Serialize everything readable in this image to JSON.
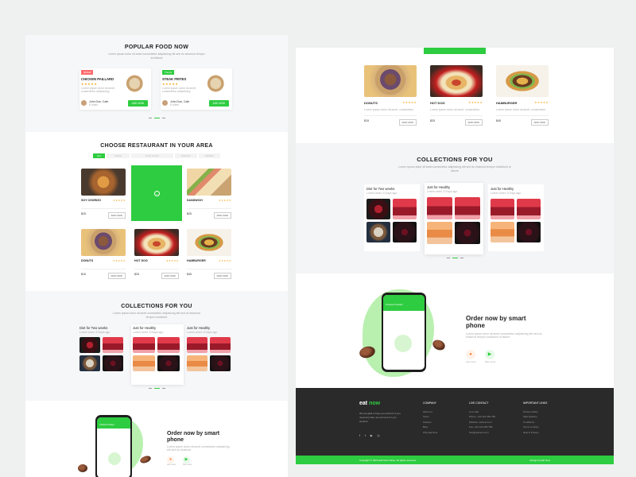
{
  "left": {
    "popular": {
      "title": "POPULAR FOOD NOW",
      "subtitle": "Lorem ipsum dolor sit amet consectetur adipisicing elit sed do eiusmod tempor incididunt",
      "cards": [
        {
          "badge": "30%off",
          "name": "CHICKEN PAILLARD",
          "stars": "★★★★★",
          "desc": "Lorem ipsum dolor sit amet consectetur adipisicing",
          "author": "John Doe, Cafe",
          "meta": "8 miles",
          "button": "ADD NOW"
        },
        {
          "badge": "Trendy",
          "name": "STEAK FRITES",
          "stars": "★★★★★",
          "desc": "Lorem ipsum dolor sit amet consectetur adipisicing",
          "author": "John Doe, Cafe",
          "meta": "8 miles",
          "button": "ADD NOW"
        }
      ]
    },
    "restaurant": {
      "title": "CHOOSE RESTAURANT IN YOUR AREA",
      "tabs": [
        "ALL",
        "PIZZA",
        "FAST FOOD",
        "STEAKS",
        "DRINKS"
      ],
      "items": [
        {
          "name": "SOY CHORIZO",
          "stars": "★★★★★",
          "price": "$25",
          "button": "ADD NOW",
          "img": "food-pizza"
        },
        {
          "name": "SANDWICH",
          "stars": "★★★★★",
          "price": "$25",
          "button": "ADD NOW",
          "img": "food-sandwich"
        },
        {
          "name": "DONUTS",
          "stars": "★★★★★",
          "price": "$15",
          "button": "ADD NOW",
          "img": "food-donut"
        },
        {
          "name": "HOT DOG",
          "stars": "★★★★★",
          "price": "$25",
          "button": "ADD NOW",
          "img": "food-hotdog"
        },
        {
          "name": "HAMBURGER",
          "stars": "★★★★★",
          "price": "$45",
          "button": "ADD NOW",
          "img": "food-burger"
        }
      ]
    },
    "collections": {
      "title": "COLLECTIONS FOR YOU",
      "subtitle": "Lorem ipsum dolor sit amet consectetur adipisicing elit sed do eiusmod tempor incididunt",
      "cards": [
        {
          "title": "Diet for Two weeks",
          "meta": "Lorem amet, 5 Days ago"
        },
        {
          "title": "Just for Healthy",
          "meta": "Lorem amet, 5 Days ago"
        },
        {
          "title": "Just for Healthy",
          "meta": "Lorem amet, 5 Days ago"
        }
      ]
    },
    "order": {
      "title": "Order now by smart phone",
      "desc": "Lorem ipsum dolor sit amet consectetur adipisicing elit sed do eiusmod",
      "app_store": "App store",
      "play_store": "Play store",
      "screen_header": "Choose Position"
    }
  },
  "right": {
    "foods": [
      {
        "name": "DONUTS",
        "stars": "★★★★★",
        "desc": "Lorem ipsum dolor sit amet, consectetur",
        "price": "$15",
        "button": "ADD NOW",
        "img": "food-donut"
      },
      {
        "name": "HOT DOG",
        "stars": "★★★★★",
        "desc": "Lorem ipsum dolor sit amet, consectetur",
        "price": "$25",
        "button": "ADD NOW",
        "img": "food-hotdog"
      },
      {
        "name": "HAMBURGER",
        "stars": "★★★★★",
        "desc": "Lorem ipsum dolor sit amet, consectetur",
        "price": "$45",
        "button": "ADD NOW",
        "img": "food-burger"
      }
    ],
    "collections": {
      "title": "COLLECTIONS FOR YOU",
      "subtitle": "Lorem ipsum dolor sit amet consectetur adipisicing elit sed do eiusmod tempor incididunt ut labore",
      "cards": [
        {
          "title": "Diet for Two weeks",
          "meta": "Lorem amet, 5 Days ago"
        },
        {
          "title": "Just for Healthy",
          "meta": "Lorem amet, 5 Days ago"
        },
        {
          "title": "Just for Healthy",
          "meta": "Lorem amet, 5 Days ago"
        }
      ]
    },
    "order": {
      "title": "Order now by smart phone",
      "desc": "Lorem ipsum dolor sit amet consectetur adipisicing elit sed do eiusmod tempor incididunt ut labore",
      "app_store": "App store",
      "play_store": "Play store",
      "screen_header": "Choose Position"
    },
    "footer": {
      "brand_a": "eat",
      "brand_b": "now",
      "about": "We are glad to have you around. If you need any help, we are here for you anytime.",
      "columns": [
        {
          "title": "COMPANY",
          "links": [
            "About us",
            "Team",
            "Careers",
            "Blog",
            "Why Eat Now"
          ]
        },
        {
          "title": "LIVE CONTACT",
          "links": [
            "Live chat",
            "Phone: +00 123 456 789",
            "Website: eatnow.com",
            "Fax: +00 123 456 789",
            "help@eatnow.com"
          ]
        },
        {
          "title": "IMPORTANT LINKS",
          "links": [
            "Privacy Policy",
            "Safe Delivery",
            "Conditions",
            "Terms & policy",
            "Help & Privacy"
          ]
        }
      ],
      "copyright": "Copyright © 2021 Eat Now Online. All rights reserved.",
      "credit": "Design by Eat Now"
    }
  }
}
